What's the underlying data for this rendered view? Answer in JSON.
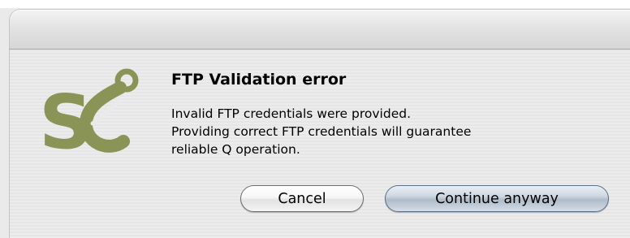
{
  "dialog": {
    "heading": "FTP Validation error",
    "message_lines": [
      "Invalid FTP credentials were provided.",
      "Providing correct FTP credentials will guarantee",
      "reliable Q operation."
    ],
    "logo": {
      "icon": "se-logo-icon",
      "text": "Se",
      "color": "#8a9456"
    },
    "buttons": {
      "cancel_label": "Cancel",
      "continue_label": "Continue anyway"
    }
  }
}
